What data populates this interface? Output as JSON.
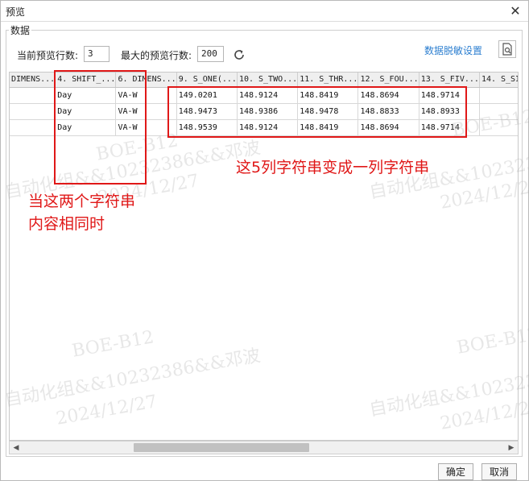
{
  "window": {
    "title": "预览",
    "close_glyph": "✕"
  },
  "group": {
    "label": "数据"
  },
  "controls": {
    "current_rows_label": "当前预览行数:",
    "current_rows_value": "3",
    "max_rows_label": "最大的预览行数:",
    "max_rows_value": "200",
    "mask_settings_link": "数据脱敏设置"
  },
  "table": {
    "columns": [
      "DIMENS...",
      "4. SHIFT_...",
      "6. DIMENS...",
      "9. S_ONE(...",
      "10. S_TWO...",
      "11. S_THR...",
      "12. S_FOU...",
      "13. S_FIV...",
      "14. S_SI"
    ],
    "rows": [
      [
        "",
        "Day",
        "VA-W",
        "149.0201",
        "148.9124",
        "148.8419",
        "148.8694",
        "148.9714",
        ""
      ],
      [
        "",
        "Day",
        "VA-W",
        "148.9473",
        "148.9386",
        "148.9478",
        "148.8833",
        "148.8933",
        ""
      ],
      [
        "",
        "Day",
        "VA-W",
        "148.9539",
        "148.9124",
        "148.8419",
        "148.8694",
        "148.9714",
        ""
      ]
    ]
  },
  "scrollbar": {
    "left_arrow": "◀",
    "right_arrow": "▶"
  },
  "buttons": {
    "ok": "确定",
    "cancel": "取消"
  },
  "watermark": {
    "line1": "BOE-B12",
    "line2": "自动化组&&10232386&&邓波",
    "line3": "2024/12/27"
  },
  "annotations": {
    "left_text_line1": "当这两个字符串",
    "left_text_line2": "内容相同时",
    "right_text": "这5列字符串变成一列字符串",
    "color": "#e01818"
  },
  "colors": {
    "link": "#2d7fd0",
    "header_bg": "#efefef",
    "annotation_red": "#e01818"
  }
}
